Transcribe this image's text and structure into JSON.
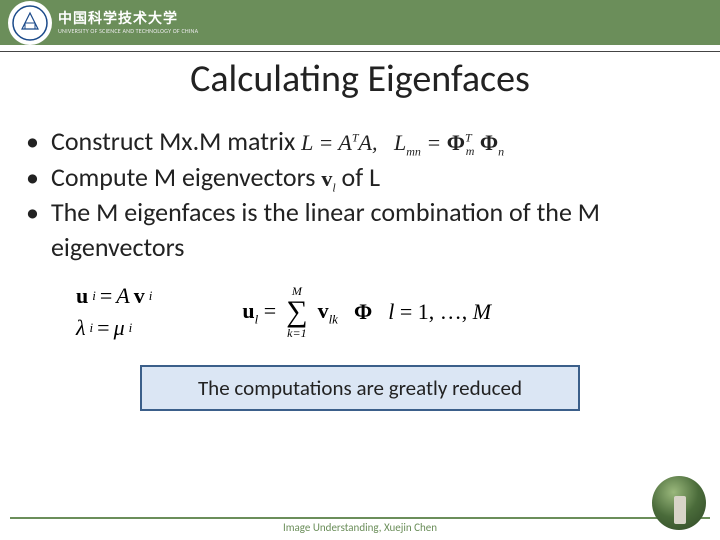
{
  "header": {
    "uni_cn": "中国科学技术大学",
    "uni_en": "UNIVERSITY OF SCIENCE AND TECHNOLOGY OF CHINA"
  },
  "title": "Calculating Eigenfaces",
  "bullets": {
    "b1_pre": "Construct Mx.M matrix ",
    "b1_math": "L = AᵀA,   Lₘₙ = Φᵀₘ Φₙ",
    "b2_pre": "Compute M eigenvectors ",
    "b2_mid": "vₗ",
    "b2_post": " of L",
    "b3": "The M eigenfaces is the linear combination of the M eigenvectors"
  },
  "equations": {
    "left1": "uᵢ = Avᵢ",
    "left2": "λᵢ = μᵢ",
    "center_sum_top": "M",
    "center_sum_bot": "k=1",
    "right_cond": "l = 1, …, M"
  },
  "callout": "The computations are greatly reduced",
  "footer": "Image Understanding, Xuejin Chen"
}
